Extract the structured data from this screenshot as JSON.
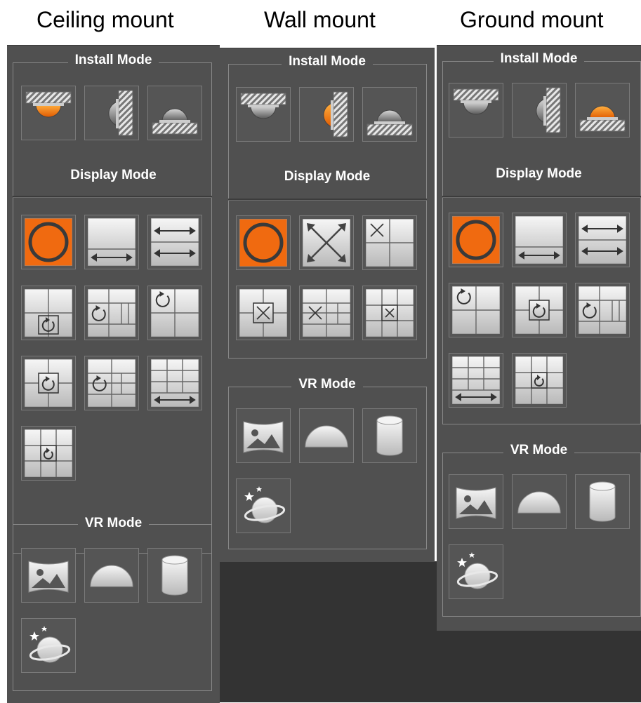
{
  "captions": {
    "ceiling": "Ceiling mount",
    "wall": "Wall mount",
    "ground": "Ground mount"
  },
  "panels": {
    "ceiling": {
      "install_title": "Install Mode",
      "display_title": "Display Mode",
      "vr_title": "VR Mode",
      "install_selected": "ceiling",
      "display_buttons": [
        "fisheye-original",
        "panorama-180",
        "dual-panorama",
        "1p-plus-1r",
        "1p-plus-3r",
        "1o-plus-3r",
        "1o-plus-1r",
        "1o-plus-4r",
        "2p-plus-4r",
        "1o-plus-8r"
      ],
      "vr_buttons": [
        "vr-panorama",
        "vr-hemisphere",
        "vr-cylinder",
        "vr-asteroid"
      ],
      "display_selected": "fisheye-original"
    },
    "wall": {
      "install_title": "Install Mode",
      "display_title": "Display Mode",
      "vr_title": "VR Mode",
      "install_selected": "wall",
      "display_buttons": [
        "fisheye-original",
        "panorama-expand",
        "1p-plus-3r",
        "1o-plus-3r-quad",
        "1p-plus-6r",
        "1p-plus-8r"
      ],
      "vr_buttons": [
        "vr-panorama",
        "vr-hemisphere",
        "vr-cylinder",
        "vr-asteroid"
      ],
      "display_selected": "fisheye-original"
    },
    "ground": {
      "install_title": "Install Mode",
      "display_title": "Display Mode",
      "vr_title": "VR Mode",
      "install_selected": "ground",
      "display_buttons": [
        "fisheye-original",
        "panorama-180",
        "dual-panorama",
        "1o-plus-3r",
        "1o-plus-1r",
        "1p-plus-4r",
        "2p-plus-4r",
        "1o-plus-8r"
      ],
      "vr_buttons": [
        "vr-panorama",
        "vr-hemisphere",
        "vr-cylinder",
        "vr-asteroid"
      ],
      "display_selected": "fisheye-original"
    }
  },
  "colors": {
    "panel_bg": "#505050",
    "accent_orange": "#f06a10",
    "caption_text": "#000000",
    "title_text": "#ffffff"
  }
}
